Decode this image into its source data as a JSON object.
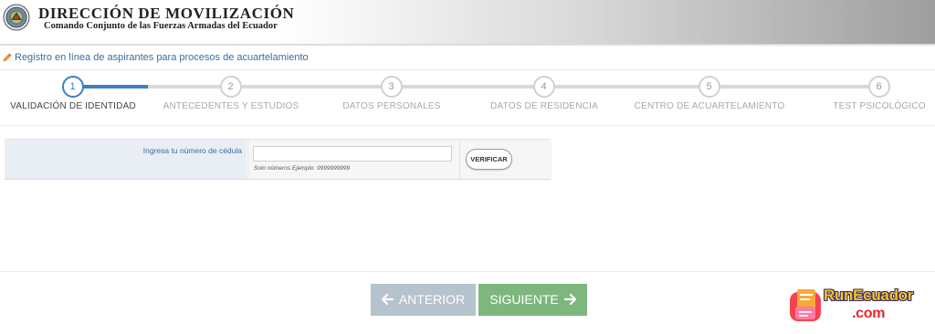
{
  "header": {
    "title": "DIRECCIÓN DE MOVILIZACIÓN",
    "subtitle": "Comando Conjunto de las Fuerzas Armadas del Ecuador",
    "emblem_icon": "military-seal-emblem"
  },
  "registration": {
    "icon": "pencil-icon",
    "text": "Registro en línea de aspirantes para procesos de acuartelamiento"
  },
  "steps": [
    {
      "number": "1",
      "label": "VALIDACIÓN DE IDENTIDAD",
      "active": true
    },
    {
      "number": "2",
      "label": "ANTECEDENTES Y ESTUDIOS",
      "active": false
    },
    {
      "number": "3",
      "label": "DATOS PERSONALES",
      "active": false
    },
    {
      "number": "4",
      "label": "DATOS DE RESIDENCIA",
      "active": false
    },
    {
      "number": "5",
      "label": "CENTRO DE ACUARTELAMIENTO",
      "active": false
    },
    {
      "number": "6",
      "label": "TEST PSICOLÓGICO",
      "active": false
    }
  ],
  "form": {
    "label": "Ingresa tu número de cédula",
    "value": "",
    "placeholder": "",
    "hint": "Solo números Ejemplo: 9999999999",
    "verify_label": "VERIFICAR"
  },
  "nav": {
    "previous_label": "ANTERIOR",
    "previous_icon": "arrow-left-icon",
    "next_label": "SIGUIENTE",
    "next_icon": "arrow-right-icon"
  },
  "watermark": {
    "line1": "RunEcuador",
    "line2": ".com"
  },
  "colors": {
    "accent": "#3c7fc4",
    "next_button": "#7db77d",
    "prev_button": "#b5c3cc"
  }
}
